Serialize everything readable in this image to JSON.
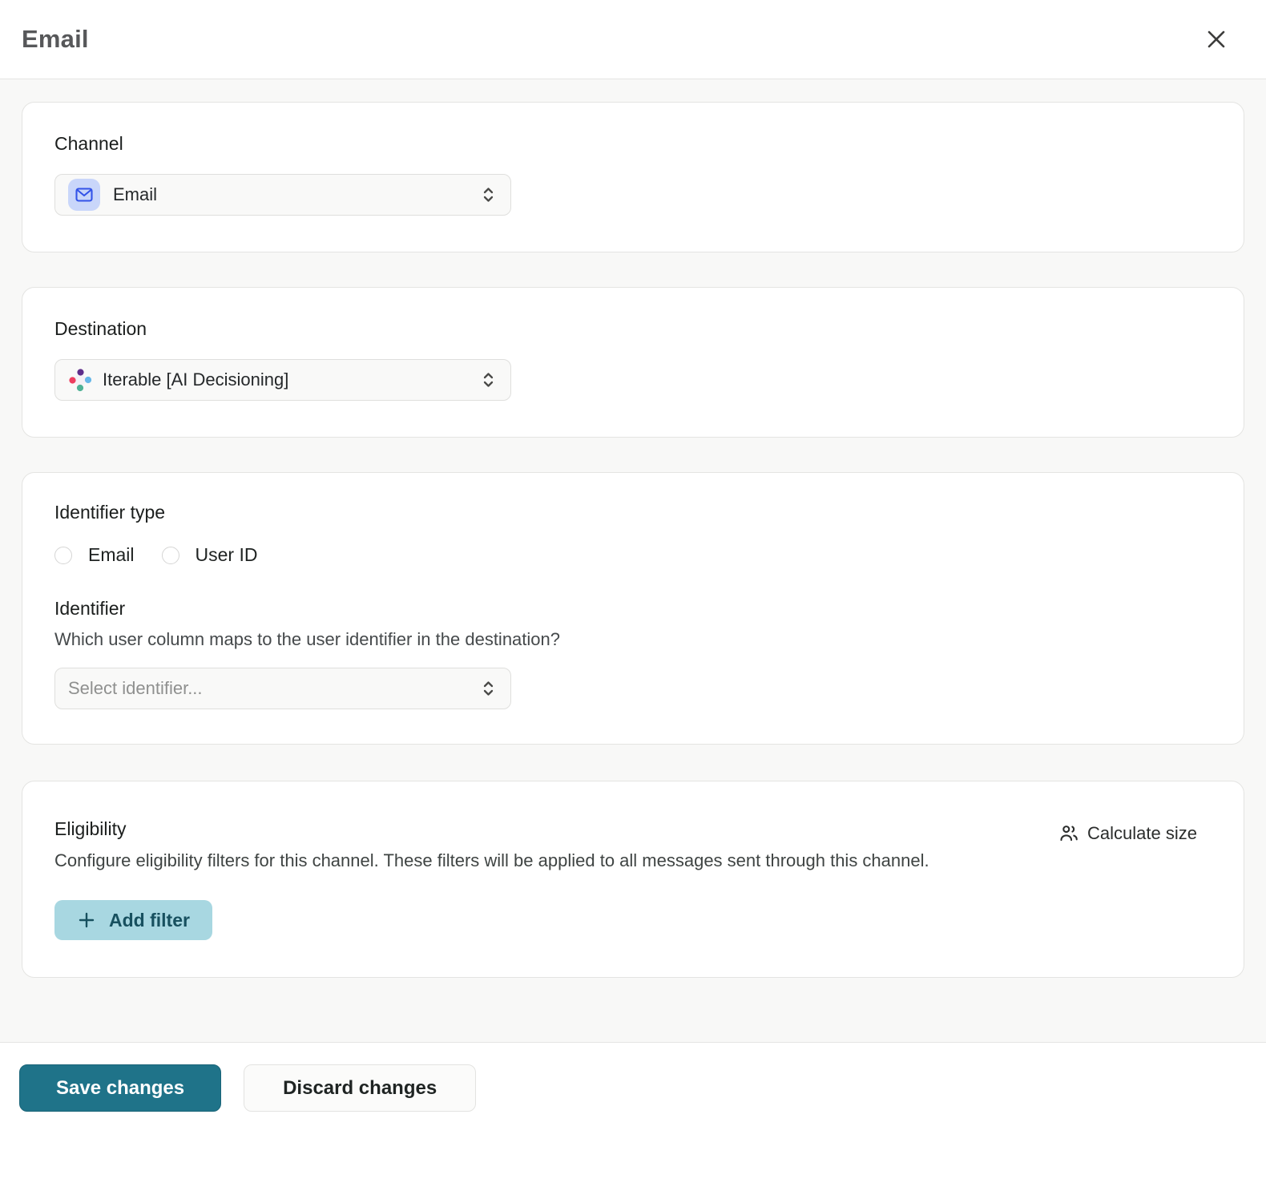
{
  "header": {
    "title": "Email"
  },
  "channel_card": {
    "label": "Channel",
    "select_value": "Email",
    "icon": "email-icon"
  },
  "destination_card": {
    "label": "Destination",
    "select_value": "Iterable [AI Decisioning]",
    "icon": "iterable-logo-icon"
  },
  "identifier_card": {
    "type_label": "Identifier type",
    "radios": [
      {
        "label": "Email",
        "checked": false
      },
      {
        "label": "User ID",
        "checked": false
      }
    ],
    "identifier_label": "Identifier",
    "identifier_help": "Which user column maps to the user identifier in the destination?",
    "select_placeholder": "Select identifier..."
  },
  "eligibility_card": {
    "title": "Eligibility",
    "description": "Configure eligibility filters for this channel. These filters will be applied to all messages sent through this channel.",
    "calculate_size_label": "Calculate size",
    "add_filter_label": "Add filter"
  },
  "footer": {
    "save_label": "Save changes",
    "discard_label": "Discard changes"
  },
  "colors": {
    "accent_teal": "#1f7389",
    "add_filter_bg": "#a8d7e1",
    "add_filter_text": "#17505f",
    "email_icon_bg": "#c9d6fa",
    "email_icon_stroke": "#3353e8",
    "iterable_purple": "#5e2d8a",
    "iterable_red": "#ee3e5f",
    "iterable_blue": "#66b7e8",
    "iterable_green": "#4fb295",
    "content_bg": "#f8f8f7"
  }
}
